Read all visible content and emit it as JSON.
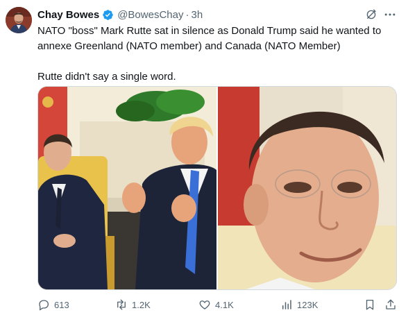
{
  "author": {
    "name": "Chay Bowes",
    "handle": "@BowesChay",
    "separator": "·",
    "time": "3h",
    "verified": true
  },
  "tweet": {
    "paragraphs": [
      "NATO \"boss\" Mark Rutte sat in silence as Donald Trump said he wanted to annexe Greenland (NATO member) and Canada (NATO Member)",
      "Rutte didn't say a single word."
    ]
  },
  "metrics": {
    "replies": "613",
    "reposts": "1.2K",
    "likes": "4.1K",
    "views": "123K"
  },
  "icons": {
    "verified": "verified-badge-icon",
    "grok": "grok-icon",
    "more": "more-icon",
    "reply": "reply-icon",
    "repost": "repost-icon",
    "like": "heart-icon",
    "views": "views-chart-icon",
    "bookmark": "bookmark-icon",
    "share": "share-icon"
  },
  "colors": {
    "verified": "#1d9bf0",
    "text": "#0f1419",
    "secondary": "#536471",
    "border": "#cfd9de"
  }
}
